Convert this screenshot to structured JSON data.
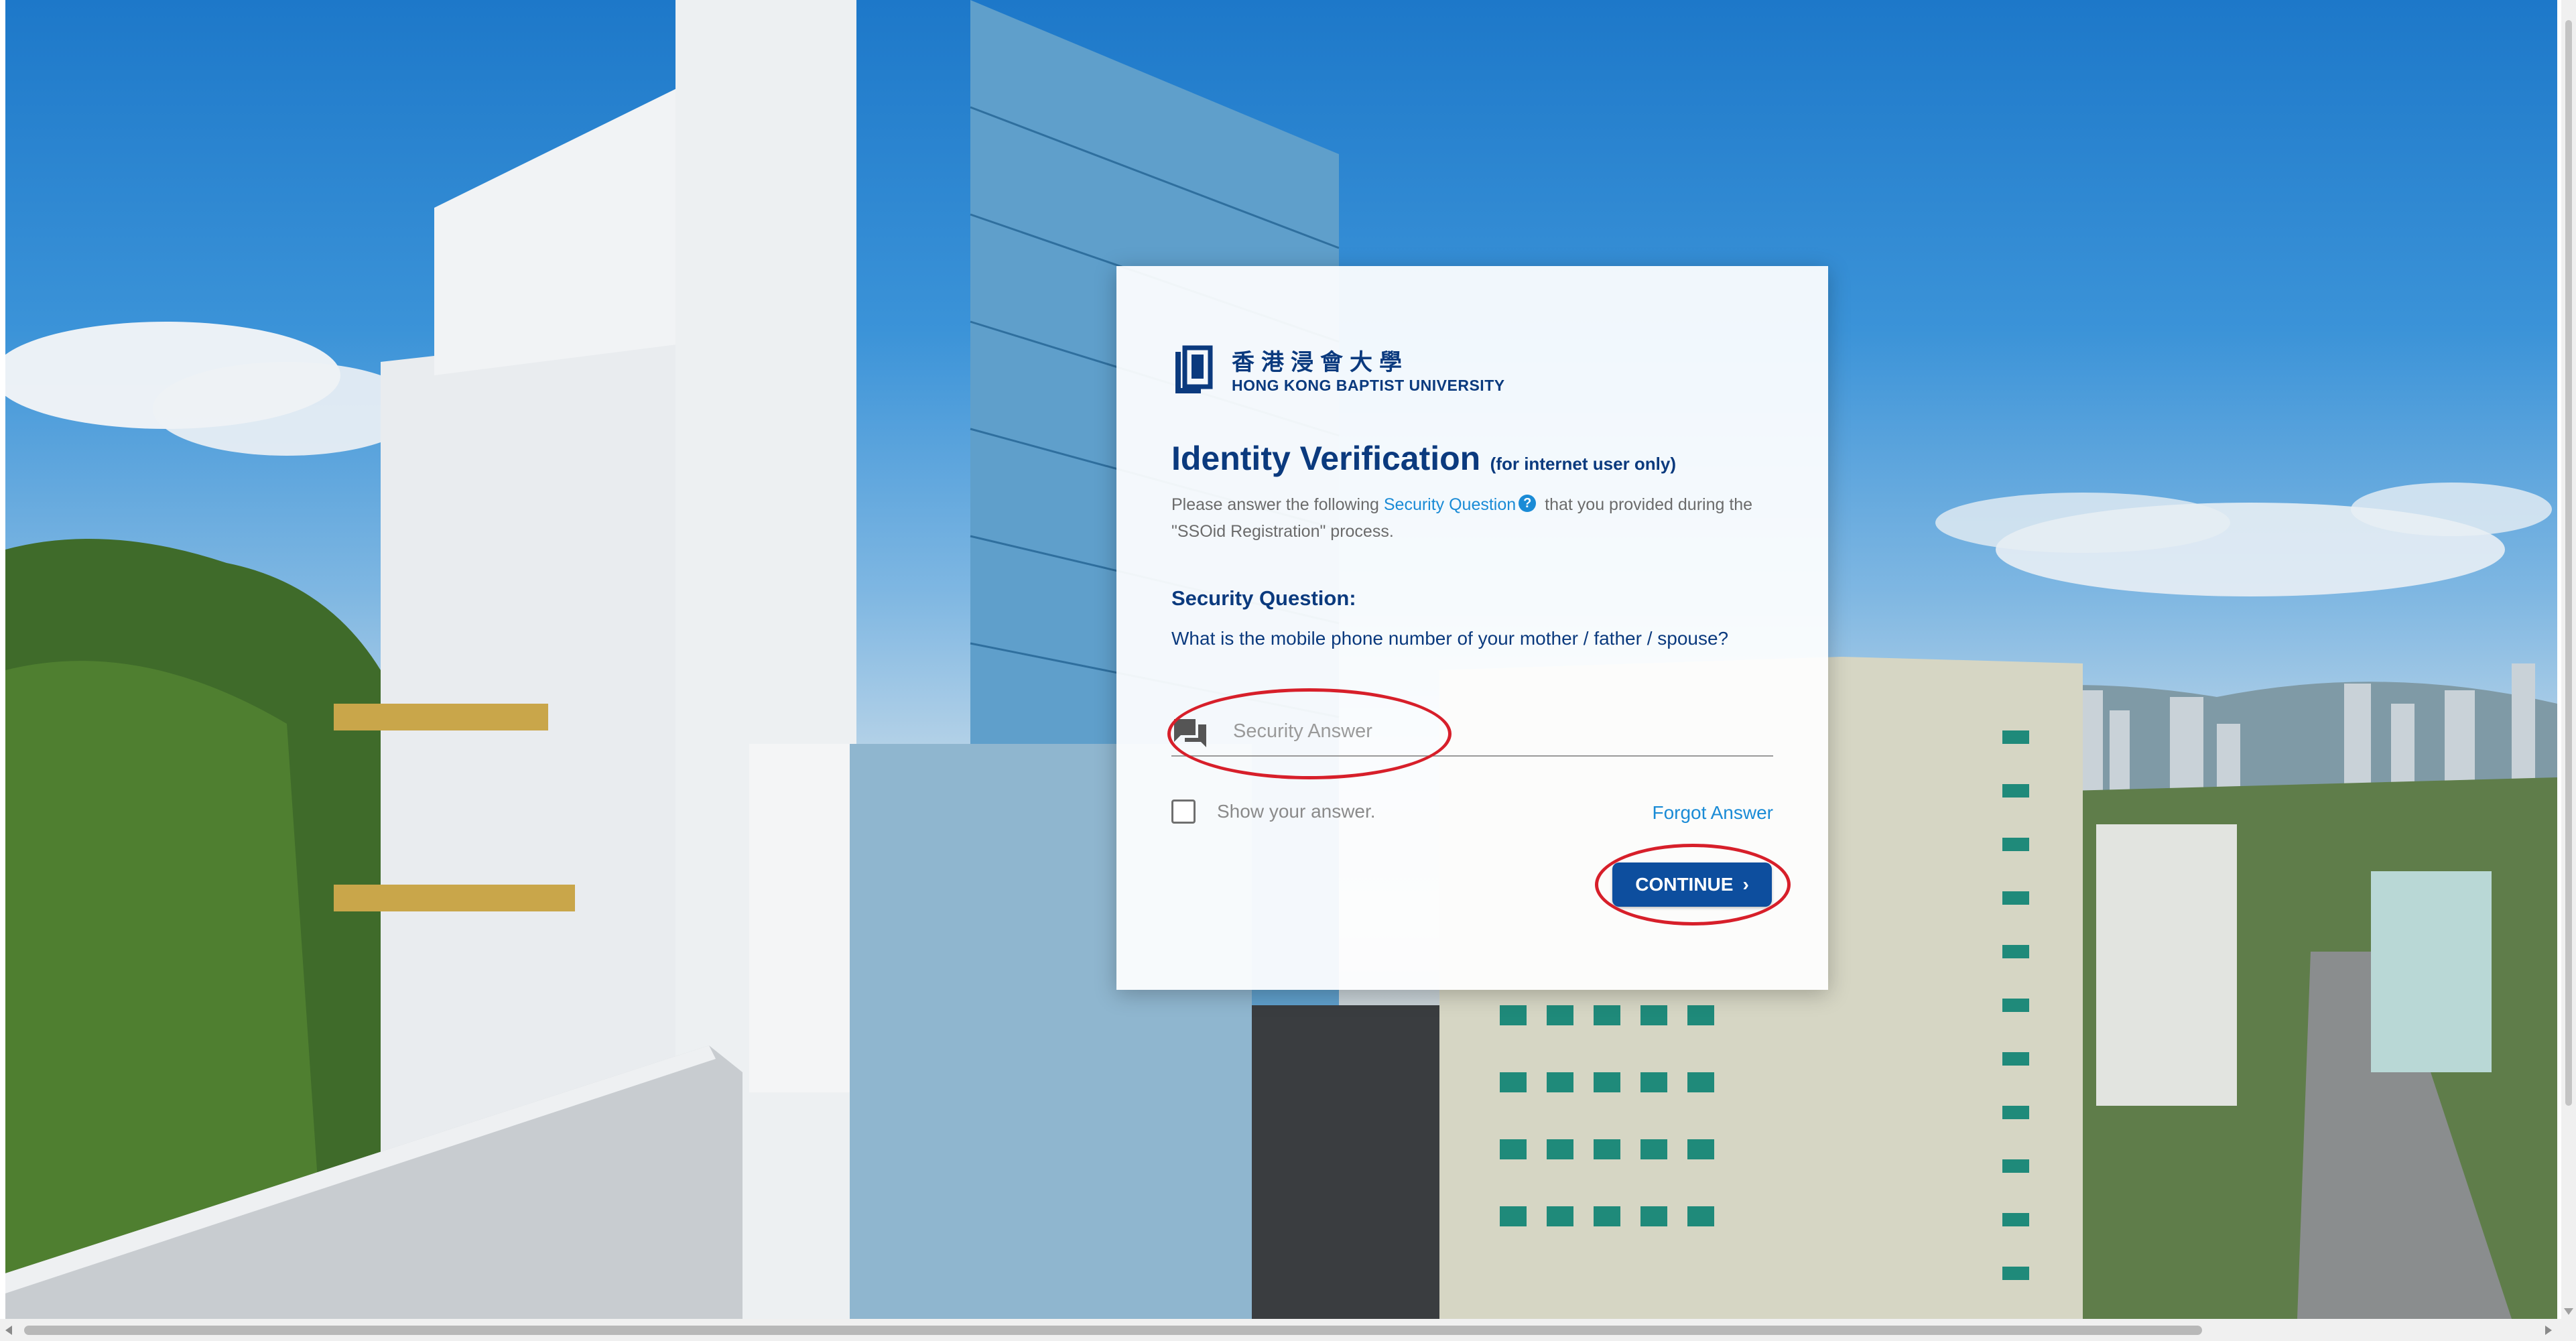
{
  "university": {
    "name_cn": "香港浸會大學",
    "name_en": "HONG KONG BAPTIST UNIVERSITY"
  },
  "heading": {
    "title": "Identity Verification",
    "note": "(for internet user only)"
  },
  "instructions": {
    "before": "Please answer the following",
    "link": "Security Question",
    "help_icon": "?",
    "after": "that you provided during the \"SSOid Registration\" process."
  },
  "security_question": {
    "label": "Security Question:",
    "text": "What is the mobile phone number of your mother / father / spouse?"
  },
  "answer": {
    "placeholder": "Security Answer",
    "value": ""
  },
  "show_answer": {
    "label": "Show your answer.",
    "checked": false
  },
  "forgot_link": "Forgot Answer",
  "continue_button": {
    "label": "CONTINUE",
    "chevron": "›"
  },
  "icons": {
    "logo": "hkbu-logo-icon",
    "chat": "chat-bubble-icon",
    "help": "help-icon"
  },
  "colors": {
    "brand_navy": "#0b3a7e",
    "link_blue": "#1a8bd6",
    "button_blue": "#0d4e9e",
    "annotation_red": "#d71f2a"
  }
}
